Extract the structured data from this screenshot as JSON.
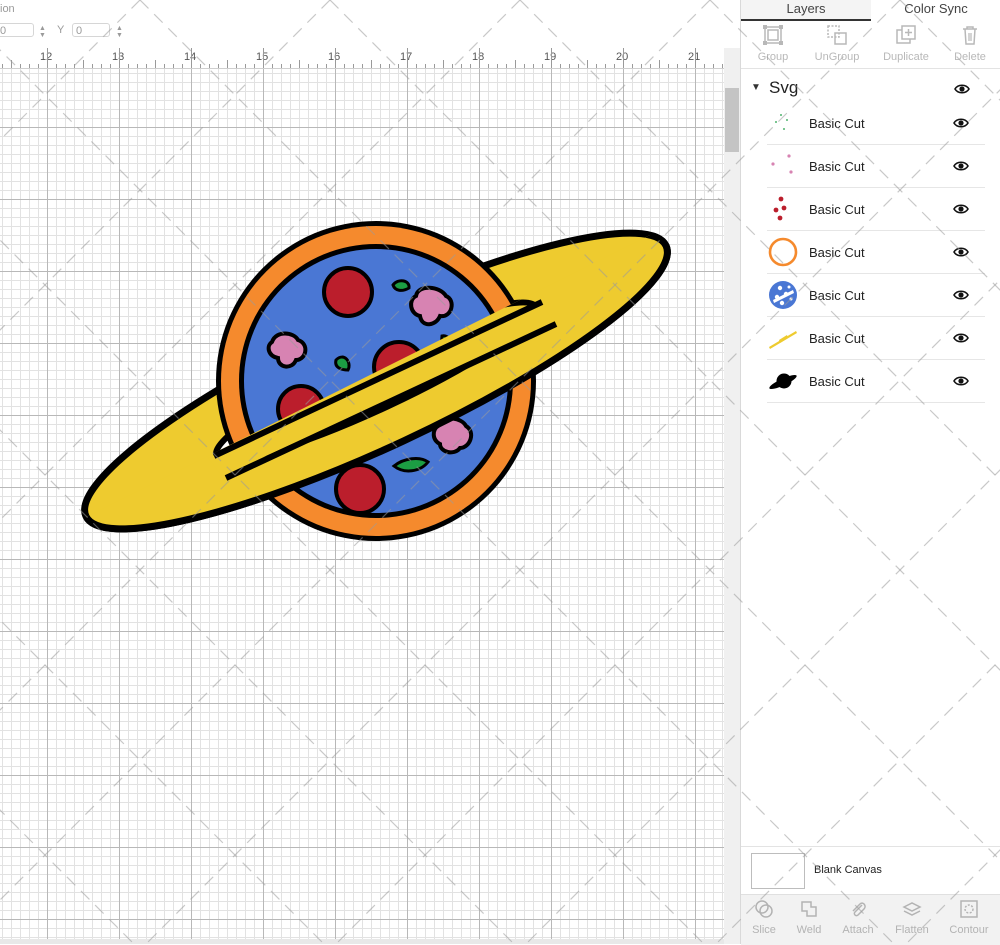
{
  "toolbar": {
    "position_label_fragment": "ion",
    "x_value": "0",
    "y_label": "Y",
    "y_value": "0"
  },
  "ruler": {
    "numbers": [
      "12",
      "13",
      "14",
      "15",
      "16",
      "17",
      "18",
      "19",
      "20",
      "21"
    ]
  },
  "artwork": {
    "ring_color": "#EECB2F",
    "rim_color": "#F58A2D",
    "planet_color": "#4A77D4",
    "pepperoni_color": "#BB1E2C",
    "mushroom_color": "#D783B2",
    "pepper_color": "#1C9D43",
    "outline_color": "#000000"
  },
  "panel": {
    "tabs": [
      "Layers",
      "Color Sync"
    ],
    "active_tab": "Layers",
    "tools": [
      {
        "label": "Group",
        "icon": "group-icon"
      },
      {
        "label": "UnGroup",
        "icon": "ungroup-icon"
      },
      {
        "label": "Duplicate",
        "icon": "duplicate-icon"
      },
      {
        "label": "Delete",
        "icon": "trash-icon"
      }
    ],
    "group_name": "Svg",
    "layers": [
      {
        "label": "Basic Cut",
        "thumb": "green-specks",
        "color": "#1C9D43"
      },
      {
        "label": "Basic Cut",
        "thumb": "pink-specks",
        "color": "#D783B2"
      },
      {
        "label": "Basic Cut",
        "thumb": "red-dots",
        "color": "#BB1E2C"
      },
      {
        "label": "Basic Cut",
        "thumb": "orange-ring",
        "color": "#F58A2D"
      },
      {
        "label": "Basic Cut",
        "thumb": "blue-planet",
        "color": "#4A77D4"
      },
      {
        "label": "Basic Cut",
        "thumb": "yellow-ring",
        "color": "#EECB2F"
      },
      {
        "label": "Basic Cut",
        "thumb": "black-silhouette",
        "color": "#000000"
      }
    ],
    "blank_canvas_label": "Blank Canvas",
    "bottom_tools": [
      {
        "label": "Slice",
        "icon": "slice-icon"
      },
      {
        "label": "Weld",
        "icon": "weld-icon"
      },
      {
        "label": "Attach",
        "icon": "attach-icon"
      },
      {
        "label": "Flatten",
        "icon": "flatten-icon"
      },
      {
        "label": "Contour",
        "icon": "contour-icon"
      }
    ]
  }
}
